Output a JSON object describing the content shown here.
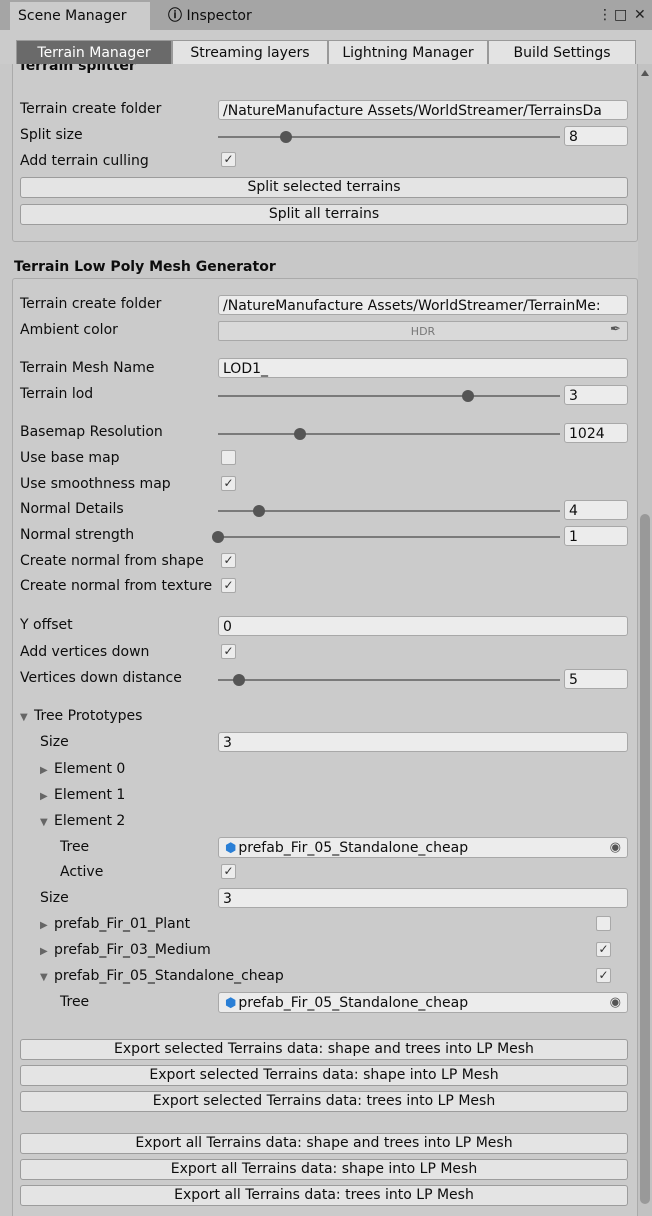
{
  "window": {
    "tabs": [
      {
        "label": "Scene Manager"
      },
      {
        "icon": "info-icon",
        "label": "Inspector"
      }
    ],
    "controls": {
      "menu": "⋮",
      "maximize": "□",
      "close": "✕"
    }
  },
  "tabs": [
    "Terrain Manager",
    "Streaming layers",
    "Lightning Manager",
    "Build Settings"
  ],
  "active_tab": "Terrain Manager",
  "terrain_splitter": {
    "title": "Terrain splitter",
    "create_folder_label": "Terrain create folder",
    "create_folder_value": "/NatureManufacture Assets/WorldStreamer/TerrainsDa",
    "split_size_label": "Split size",
    "split_size_value": "8",
    "split_size_fraction": 0.2,
    "culling_label": "Add terrain culling",
    "culling_checked": true,
    "split_selected_button": "Split selected terrains",
    "split_all_button": "Split all terrains"
  },
  "lp_generator": {
    "title": "Terrain Low Poly Mesh Generator",
    "create_folder_label": "Terrain create folder",
    "create_folder_value": "/NatureManufacture Assets/WorldStreamer/TerrainMe:",
    "ambient_label": "Ambient color",
    "ambient_value": "HDR",
    "mesh_name_label": "Terrain Mesh Name",
    "mesh_name_value": "LOD1_",
    "lod_label": "Terrain lod",
    "lod_value": "3",
    "lod_fraction": 0.73,
    "basemap_label": "Basemap Resolution",
    "basemap_value": "1024",
    "basemap_fraction": 0.24,
    "use_base_map_label": "Use base map",
    "use_base_map_checked": false,
    "use_smoothness_label": "Use smoothness map",
    "use_smoothness_checked": true,
    "normal_details_label": "Normal Details",
    "normal_details_value": "4",
    "normal_details_fraction": 0.12,
    "normal_strength_label": "Normal strength",
    "normal_strength_value": "1",
    "normal_strength_fraction": 0.0,
    "normal_shape_label": "Create normal from shape",
    "normal_shape_checked": true,
    "normal_texture_label": "Create normal from texture",
    "normal_texture_checked": true,
    "y_offset_label": "Y offset",
    "y_offset_value": "0",
    "add_vertices_label": "Add vertices down",
    "add_vertices_checked": true,
    "vertices_distance_label": "Vertices down distance",
    "vertices_distance_value": "5",
    "vertices_distance_fraction": 0.06
  },
  "tree_prototypes": {
    "label": "Tree  Prototypes",
    "size_label": "Size",
    "size_value": "3",
    "elements": [
      "Element 0",
      "Element 1",
      "Element 2"
    ],
    "tree_label": "Tree",
    "tree_value": "prefab_Fir_05_Standalone_cheap",
    "active_label": "Active",
    "active_checked": true,
    "size2_label": "Size",
    "size2_value": "3",
    "prefabs": [
      {
        "label": "prefab_Fir_01_Plant",
        "checked": false
      },
      {
        "label": "prefab_Fir_03_Medium",
        "checked": true
      },
      {
        "label": "prefab_Fir_05_Standalone_cheap",
        "checked": true
      }
    ],
    "tree2_label": "Tree",
    "tree2_value": "prefab_Fir_05_Standalone_cheap"
  },
  "export_buttons": [
    "Export selected Terrains data: shape and trees into LP Mesh",
    "Export selected Terrains data: shape into LP Mesh",
    "Export selected Terrains data: trees into LP Mesh",
    "Export all Terrains data: shape and trees into LP Mesh",
    "Export all Terrains data: shape into LP Mesh",
    "Export all Terrains data: trees into LP Mesh"
  ]
}
